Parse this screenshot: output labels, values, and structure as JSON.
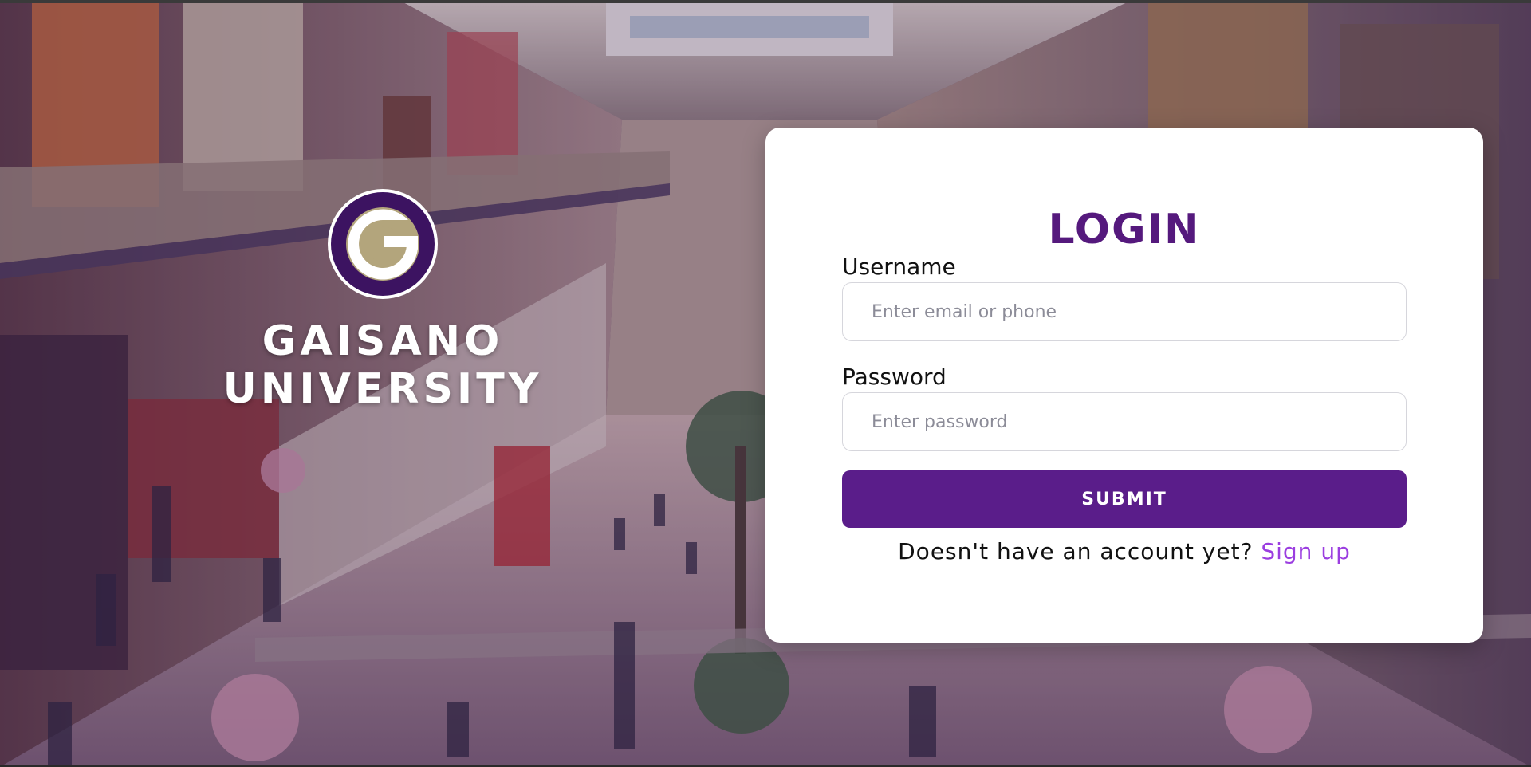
{
  "brand": {
    "logo_letter": "G",
    "name_line1": "GAISANO",
    "name_line2": "UNIVERSITY",
    "logo_icon": "gaisano-g-logo",
    "colors": {
      "purple": "#3c1361",
      "gold": "#b3a57c"
    }
  },
  "login": {
    "title": "LOGIN",
    "username": {
      "label": "Username",
      "placeholder": "Enter email or phone",
      "value": ""
    },
    "password": {
      "label": "Password",
      "placeholder": "Enter password",
      "value": ""
    },
    "submit_label": "SUBMIT",
    "signup_prompt": "Doesn't have an account yet?",
    "signup_link": "Sign up"
  },
  "colors": {
    "accent": "#5a1d8a",
    "title": "#55197d",
    "link": "#9b3ee0",
    "card": "#ffffff"
  }
}
